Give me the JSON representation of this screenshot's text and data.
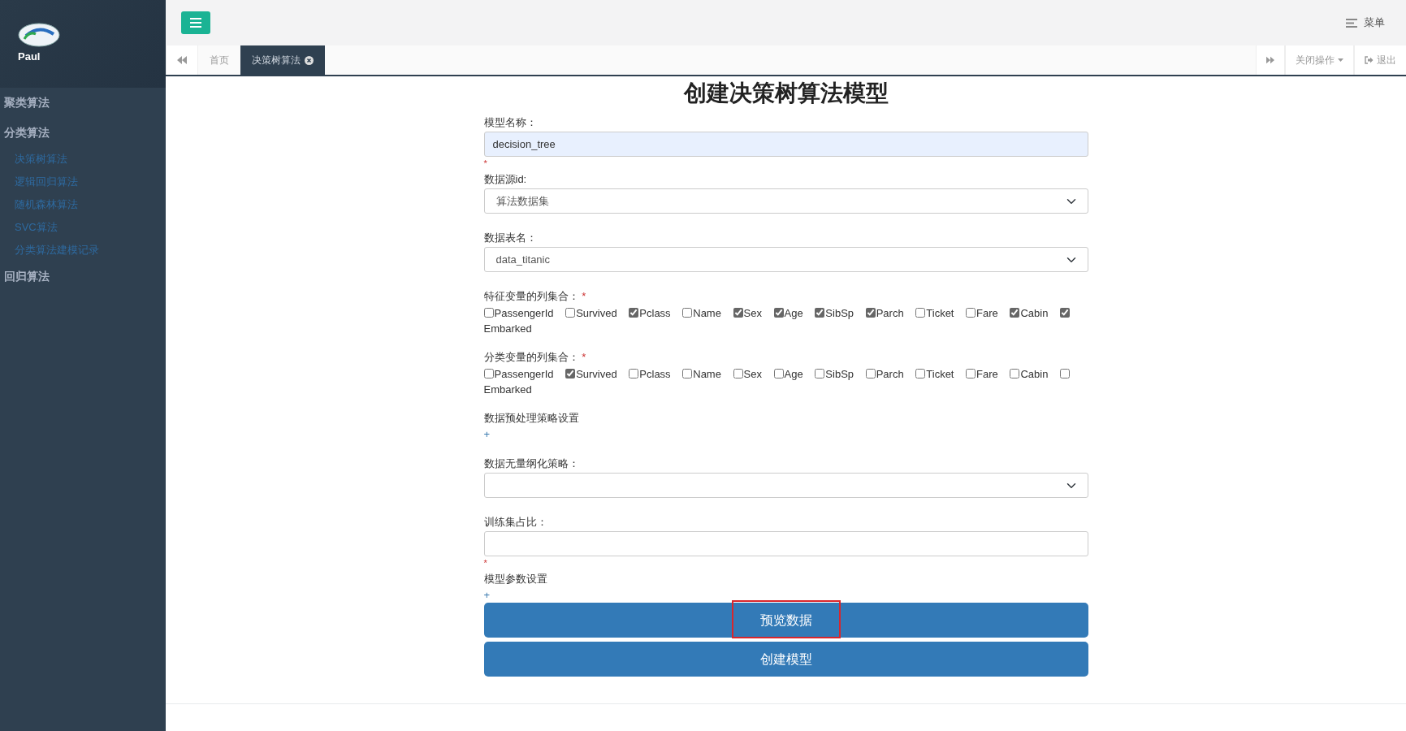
{
  "sidebar": {
    "user": "Paul",
    "menu": [
      {
        "label": "聚类算法"
      },
      {
        "label": "分类算法",
        "children": [
          {
            "label": "决策树算法"
          },
          {
            "label": "逻辑回归算法"
          },
          {
            "label": "随机森林算法"
          },
          {
            "label": "SVC算法"
          },
          {
            "label": "分类算法建模记录"
          }
        ]
      },
      {
        "label": "回归算法"
      }
    ]
  },
  "header": {
    "menu_label": "菜单"
  },
  "tabs": [
    {
      "label": "首页",
      "selected": false,
      "closable": false
    },
    {
      "label": "决策树算法",
      "selected": true,
      "closable": true
    }
  ],
  "tab_tools": {
    "close_menu": "关闭操作",
    "logout": "退出"
  },
  "form": {
    "title": "创建决策树算法模型",
    "fields": [
      {
        "kind": "text",
        "label": "模型名称：",
        "value": "decision_tree",
        "autofilled": true,
        "note": "*"
      },
      {
        "kind": "select",
        "label": "数据源id:",
        "value": "算法数据集"
      },
      {
        "kind": "select",
        "label": "数据表名：",
        "value": "data_titanic"
      },
      {
        "kind": "checkboxes",
        "label": "特征变量的列集合：",
        "star": "*",
        "options": [
          {
            "label": "PassengerId",
            "checked": false
          },
          {
            "label": "Survived",
            "checked": false
          },
          {
            "label": "Pclass",
            "checked": true
          },
          {
            "label": "Name",
            "checked": false
          },
          {
            "label": "Sex",
            "checked": true
          },
          {
            "label": "Age",
            "checked": true
          },
          {
            "label": "SibSp",
            "checked": true
          },
          {
            "label": "Parch",
            "checked": true
          },
          {
            "label": "Ticket",
            "checked": false
          },
          {
            "label": "Fare",
            "checked": false
          },
          {
            "label": "Cabin",
            "checked": true
          },
          {
            "label": "Embarked",
            "checked": true
          }
        ]
      },
      {
        "kind": "checkboxes",
        "label": "分类变量的列集合：",
        "star": "*",
        "options": [
          {
            "label": "PassengerId",
            "checked": false
          },
          {
            "label": "Survived",
            "checked": true
          },
          {
            "label": "Pclass",
            "checked": false
          },
          {
            "label": "Name",
            "checked": false
          },
          {
            "label": "Sex",
            "checked": false
          },
          {
            "label": "Age",
            "checked": false
          },
          {
            "label": "SibSp",
            "checked": false
          },
          {
            "label": "Parch",
            "checked": false
          },
          {
            "label": "Ticket",
            "checked": false
          },
          {
            "label": "Fare",
            "checked": false
          },
          {
            "label": "Cabin",
            "checked": false
          },
          {
            "label": "Embarked",
            "checked": false
          }
        ]
      },
      {
        "kind": "section",
        "label": "数据预处理策略设置",
        "toggle": "+"
      },
      {
        "kind": "select",
        "label": "数据无量纲化策略："
      },
      {
        "kind": "text",
        "label": "训练集占比：",
        "autofilled": false,
        "note": "*"
      },
      {
        "kind": "section",
        "label": "模型参数设置",
        "toggle": "+"
      }
    ],
    "buttons": [
      {
        "label": "预览数据",
        "highlighted": true
      },
      {
        "label": "创建模型",
        "highlighted": false
      }
    ]
  }
}
